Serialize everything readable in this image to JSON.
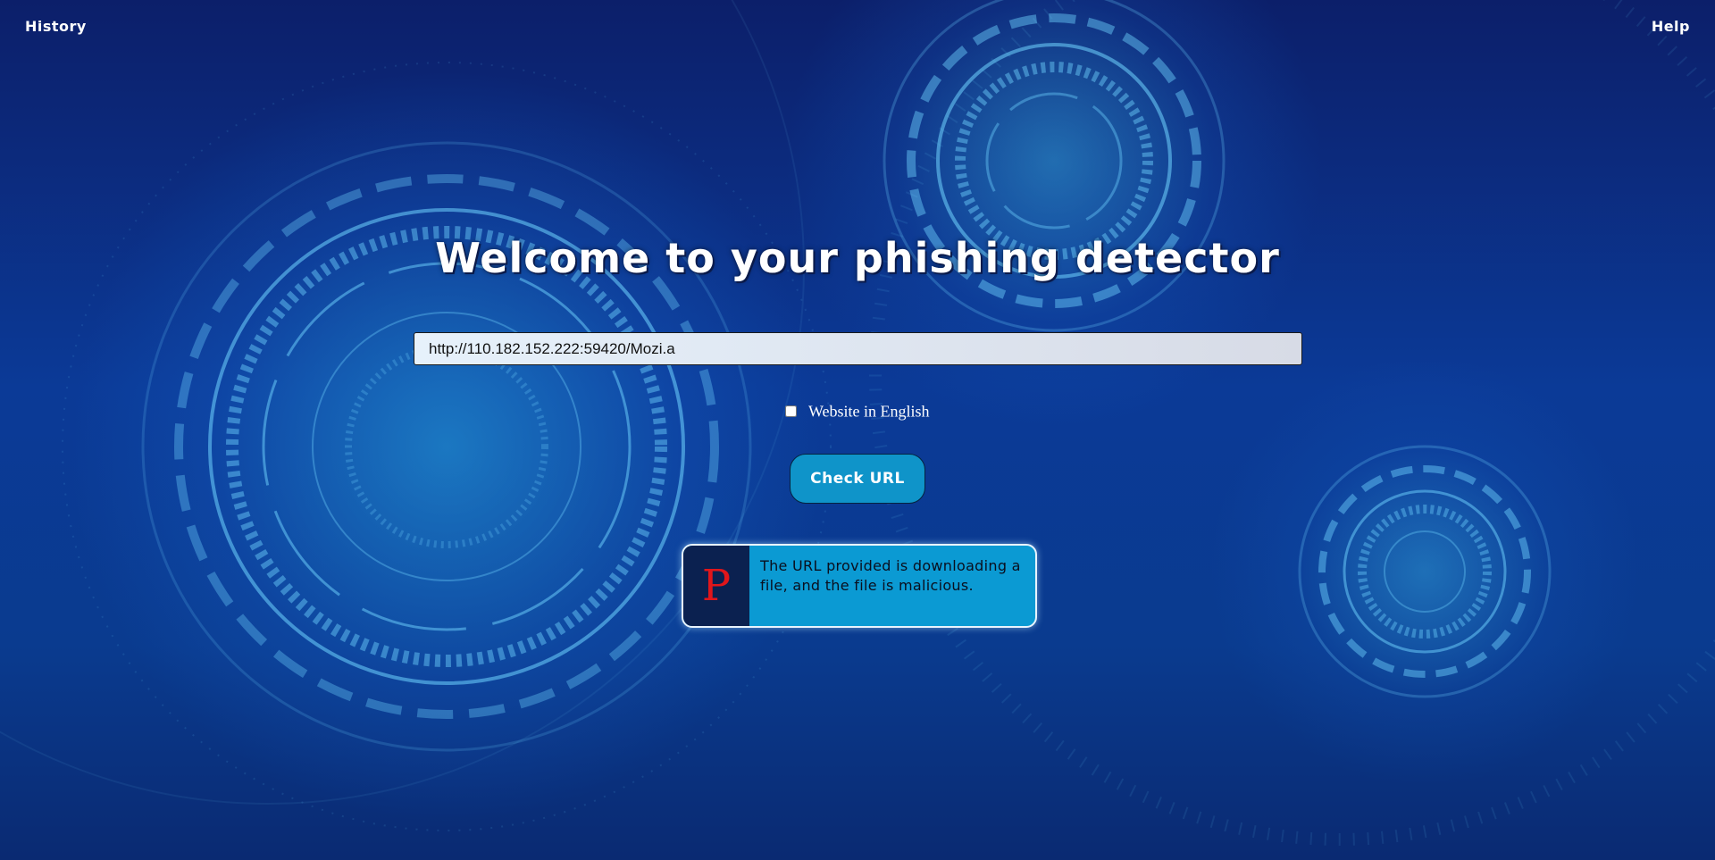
{
  "nav": {
    "history_label": "History",
    "help_label": "Help"
  },
  "main": {
    "title": "Welcome to your phishing detector",
    "url_value": "http://110.182.152.222:59420/Mozi.a",
    "english_checkbox_label": "Website in English",
    "english_checkbox_checked": false,
    "check_button_label": "Check URL"
  },
  "result": {
    "badge_letter": "P",
    "message": "The URL provided is downloading a file, and the file is malicious."
  },
  "colors": {
    "accent": "#0f94c9",
    "result_card_bg": "#0b9ad3",
    "badge_bg": "#0b2150",
    "badge_letter": "#e0161b"
  },
  "icons": {
    "badge": "phishing-letter-badge"
  }
}
